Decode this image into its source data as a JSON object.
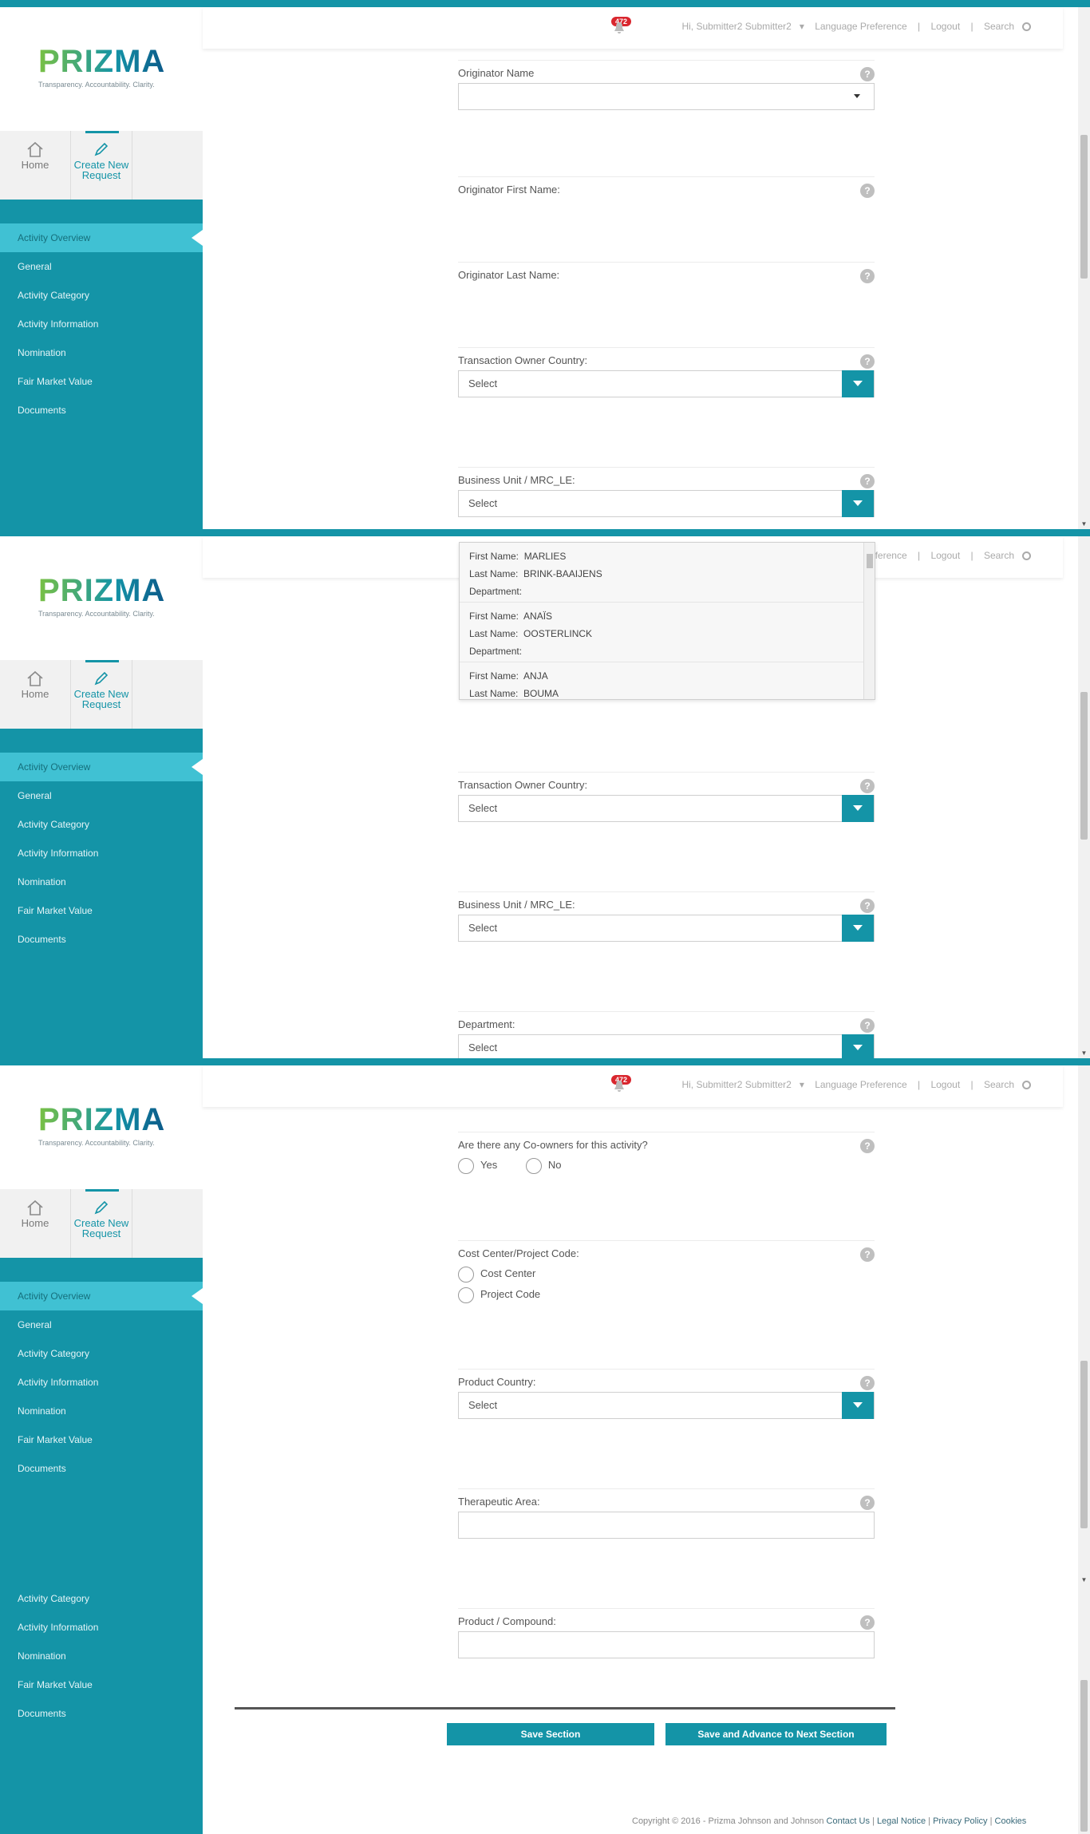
{
  "brand": {
    "logo_text": "PRIZMA",
    "tagline": "Transparency. Accountability. Clarity.",
    "accent_color": "#1494a7"
  },
  "header": {
    "notification_count": "472",
    "user_greeting": "Hi, Submitter2 Submitter2",
    "language_pref": "Language Preference",
    "logout": "Logout",
    "search": "Search",
    "separator": "|"
  },
  "quicknav": {
    "home": "Home",
    "create": "Create New Request"
  },
  "nav": {
    "items": [
      "Activity Overview",
      "General",
      "Activity Category",
      "Activity Information",
      "Nomination",
      "Fair Market Value",
      "Documents"
    ],
    "extra_items": [
      "Activity Category",
      "Activity Information",
      "Nomination",
      "Fair Market Value",
      "Documents"
    ]
  },
  "form": {
    "originator_name": "Originator Name",
    "originator_first_name": "Originator First Name:",
    "originator_last_name": "Originator Last Name:",
    "transaction_owner_country": "Transaction Owner Country:",
    "business_unit": "Business Unit / MRC_LE:",
    "department": "Department:",
    "co_owners": "Are there any Co-owners for this activity?",
    "yes": "Yes",
    "no": "No",
    "cost_center_project": "Cost Center/Project Code:",
    "cost_center": "Cost Center",
    "project_code": "Project Code",
    "product_country": "Product Country:",
    "therapeutic_area": "Therapeutic Area:",
    "product_compound": "Product / Compound:",
    "select_placeholder": "Select",
    "help": "?"
  },
  "dropdown": {
    "labels": {
      "first": "First Name:",
      "last": "Last Name:",
      "dept": "Department:"
    },
    "items": [
      {
        "first": "MARLIES",
        "last": "BRINK-BAAIJENS",
        "dept": ""
      },
      {
        "first": "ANAÏS",
        "last": "OOSTERLINCK",
        "dept": ""
      },
      {
        "first": "ANJA",
        "last": "BOUMA",
        "dept": ""
      }
    ]
  },
  "actions": {
    "save": "Save Section",
    "save_advance": "Save and Advance to Next Section"
  },
  "footer": {
    "copyright": "Copyright © 2016 - Prizma Johnson and Johnson",
    "contact": "Contact Us",
    "legal": "Legal Notice",
    "privacy": "Privacy Policy",
    "cookies": "Cookies",
    "sep": "|"
  }
}
